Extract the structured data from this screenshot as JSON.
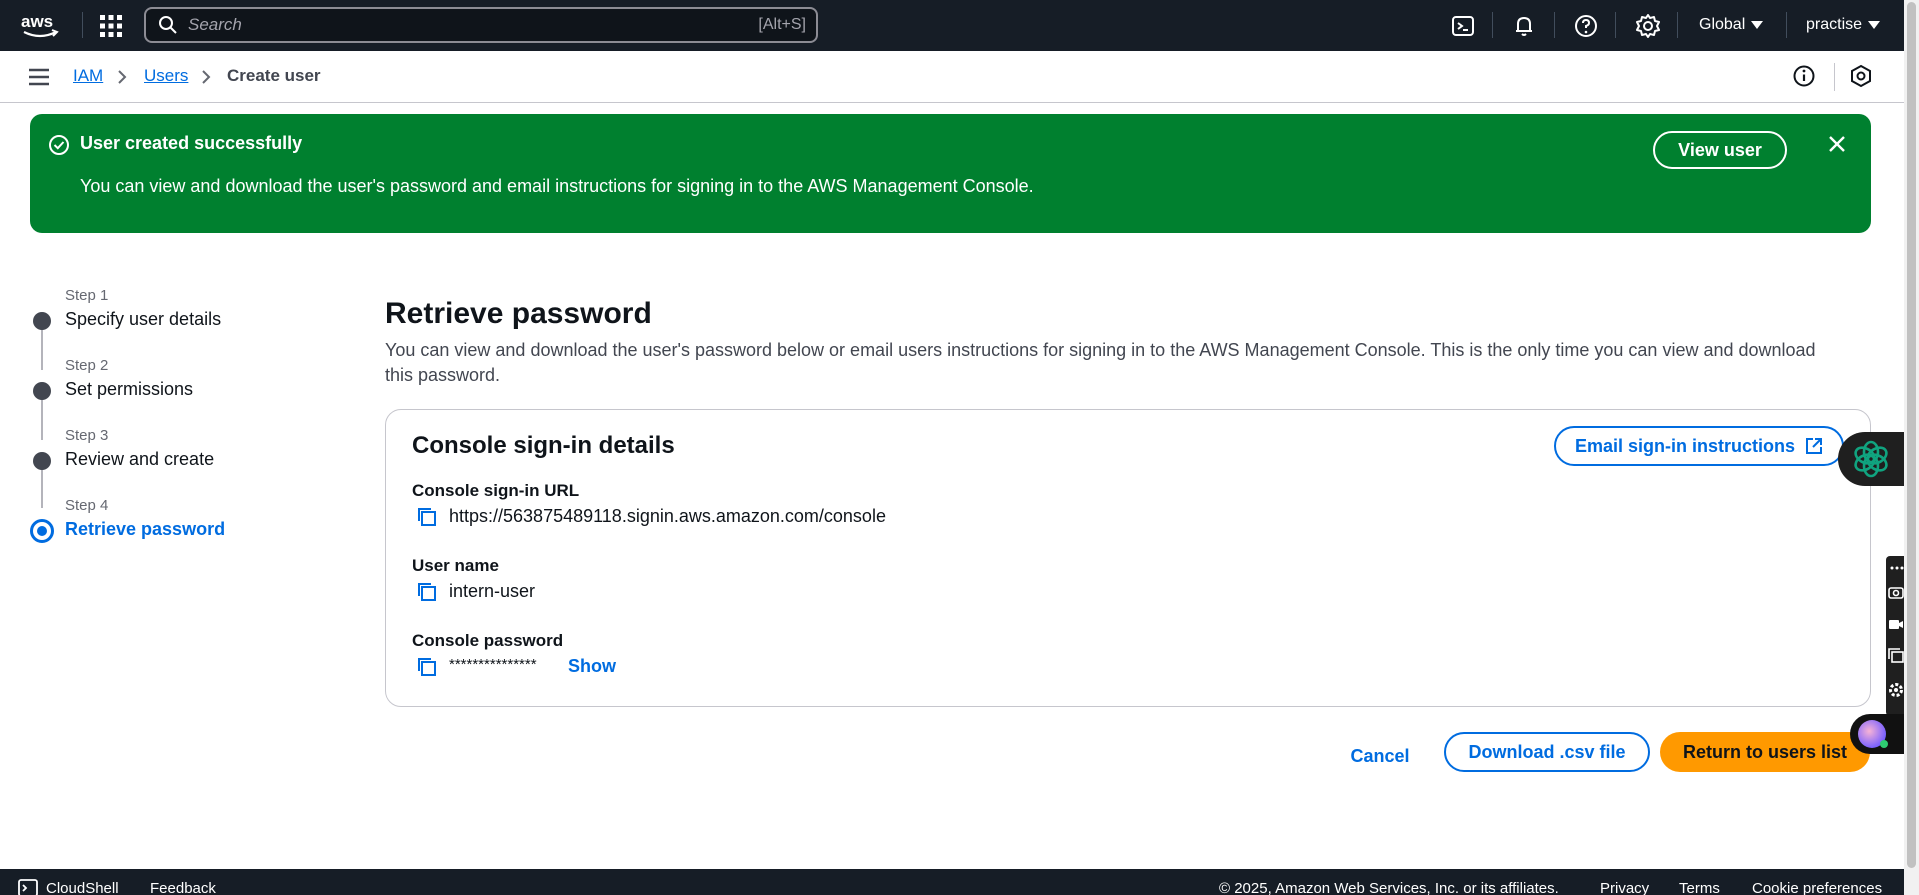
{
  "topnav": {
    "search_placeholder": "Search",
    "search_shortcut": "[Alt+S]",
    "region": "Global",
    "account": "practise"
  },
  "breadcrumb": {
    "items": [
      "IAM",
      "Users",
      "Create user"
    ]
  },
  "flash": {
    "title": "User created successfully",
    "message": "You can view and download the user's password and email instructions for signing in to the AWS Management Console.",
    "button": "View user"
  },
  "steps": [
    {
      "label": "Step 1",
      "title": "Specify user details"
    },
    {
      "label": "Step 2",
      "title": "Set permissions"
    },
    {
      "label": "Step 3",
      "title": "Review and create"
    },
    {
      "label": "Step 4",
      "title": "Retrieve password"
    }
  ],
  "main": {
    "title": "Retrieve password",
    "description": "You can view and download the user's password below or email users instructions for signing in to the AWS Management Console. This is the only time you can view and download this password."
  },
  "card": {
    "title": "Console sign-in details",
    "email_button": "Email sign-in instructions",
    "fields": [
      {
        "label": "Console sign-in URL",
        "value": "https://563875489118.signin.aws.amazon.com/console"
      },
      {
        "label": "User name",
        "value": "intern-user"
      },
      {
        "label": "Console password",
        "value": "***************",
        "action": "Show"
      }
    ]
  },
  "actions": {
    "cancel": "Cancel",
    "download": "Download .csv file",
    "return": "Return to users list"
  },
  "footer": {
    "cloudshell": "CloudShell",
    "feedback": "Feedback",
    "copyright": "© 2025, Amazon Web Services, Inc. or its affiliates.",
    "privacy": "Privacy",
    "terms": "Terms",
    "cookies": "Cookie preferences"
  },
  "colors": {
    "nav_bg": "#161d26",
    "link": "#006ce0",
    "success": "#00802f",
    "primary_button": "#ff9900"
  }
}
